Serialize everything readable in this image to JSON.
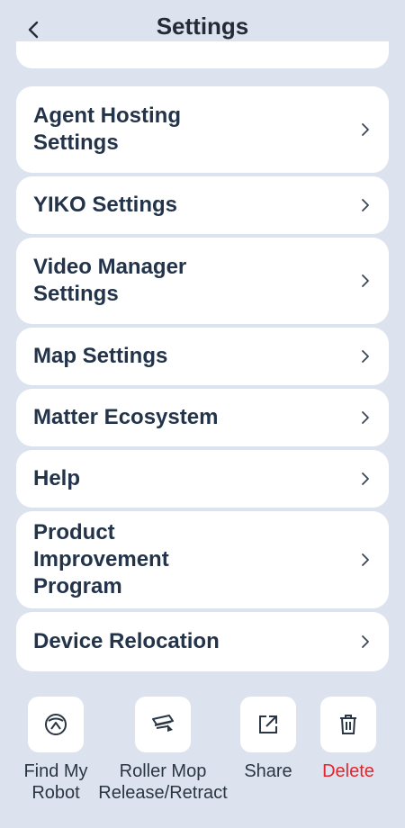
{
  "header": {
    "title": "Settings"
  },
  "settings_items": [
    {
      "label": "Agent Hosting Settings"
    },
    {
      "label": "YIKO Settings"
    },
    {
      "label": "Video Manager Settings"
    },
    {
      "label": "Map Settings"
    },
    {
      "label": "Matter Ecosystem"
    },
    {
      "label": "Help"
    },
    {
      "label": "Product Improvement Program"
    },
    {
      "label": "Device Relocation"
    }
  ],
  "actions": [
    {
      "label": "Find My Robot",
      "icon": "locate-robot-icon"
    },
    {
      "label": "Roller Mop Release/Retract",
      "icon": "roller-mop-icon"
    },
    {
      "label": "Share",
      "icon": "share-icon"
    },
    {
      "label": "Delete",
      "icon": "trash-icon",
      "color": "#e5242b"
    }
  ],
  "colors": {
    "background": "#dde3ee",
    "card": "#ffffff",
    "danger": "#e5242b",
    "text": "#23344a"
  }
}
